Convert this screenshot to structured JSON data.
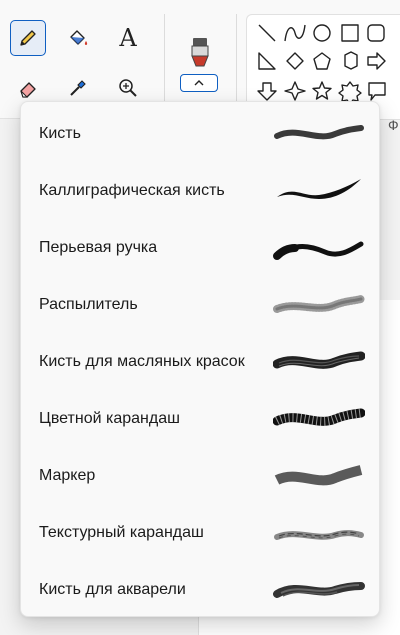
{
  "tools": {
    "pencil": "pencil-icon",
    "fill": "fill-bucket-icon",
    "text": "A",
    "eraser": "eraser-icon",
    "color_picker": "color-picker-icon",
    "magnifier": "magnifier-icon"
  },
  "brushes_button": {
    "icon": "brush-icon",
    "chevron": "chevron-up-icon"
  },
  "shapes_partial_label": "Ф",
  "brush_menu": {
    "items": [
      {
        "label": "Кисть",
        "preview": "brush"
      },
      {
        "label": "Каллиграфическая кисть",
        "preview": "calligraphy"
      },
      {
        "label": "Перьевая ручка",
        "preview": "pen"
      },
      {
        "label": "Распылитель",
        "preview": "airbrush"
      },
      {
        "label": "Кисть для масляных красок",
        "preview": "oil"
      },
      {
        "label": "Цветной карандаш",
        "preview": "crayon"
      },
      {
        "label": "Маркер",
        "preview": "marker"
      },
      {
        "label": "Текстурный карандаш",
        "preview": "pencil"
      },
      {
        "label": "Кисть для акварели",
        "preview": "watercolor"
      }
    ]
  },
  "colors": {
    "accent": "#0f5fc2",
    "menu_bg": "#f9f9f9",
    "stroke": "#1b1b1b"
  }
}
